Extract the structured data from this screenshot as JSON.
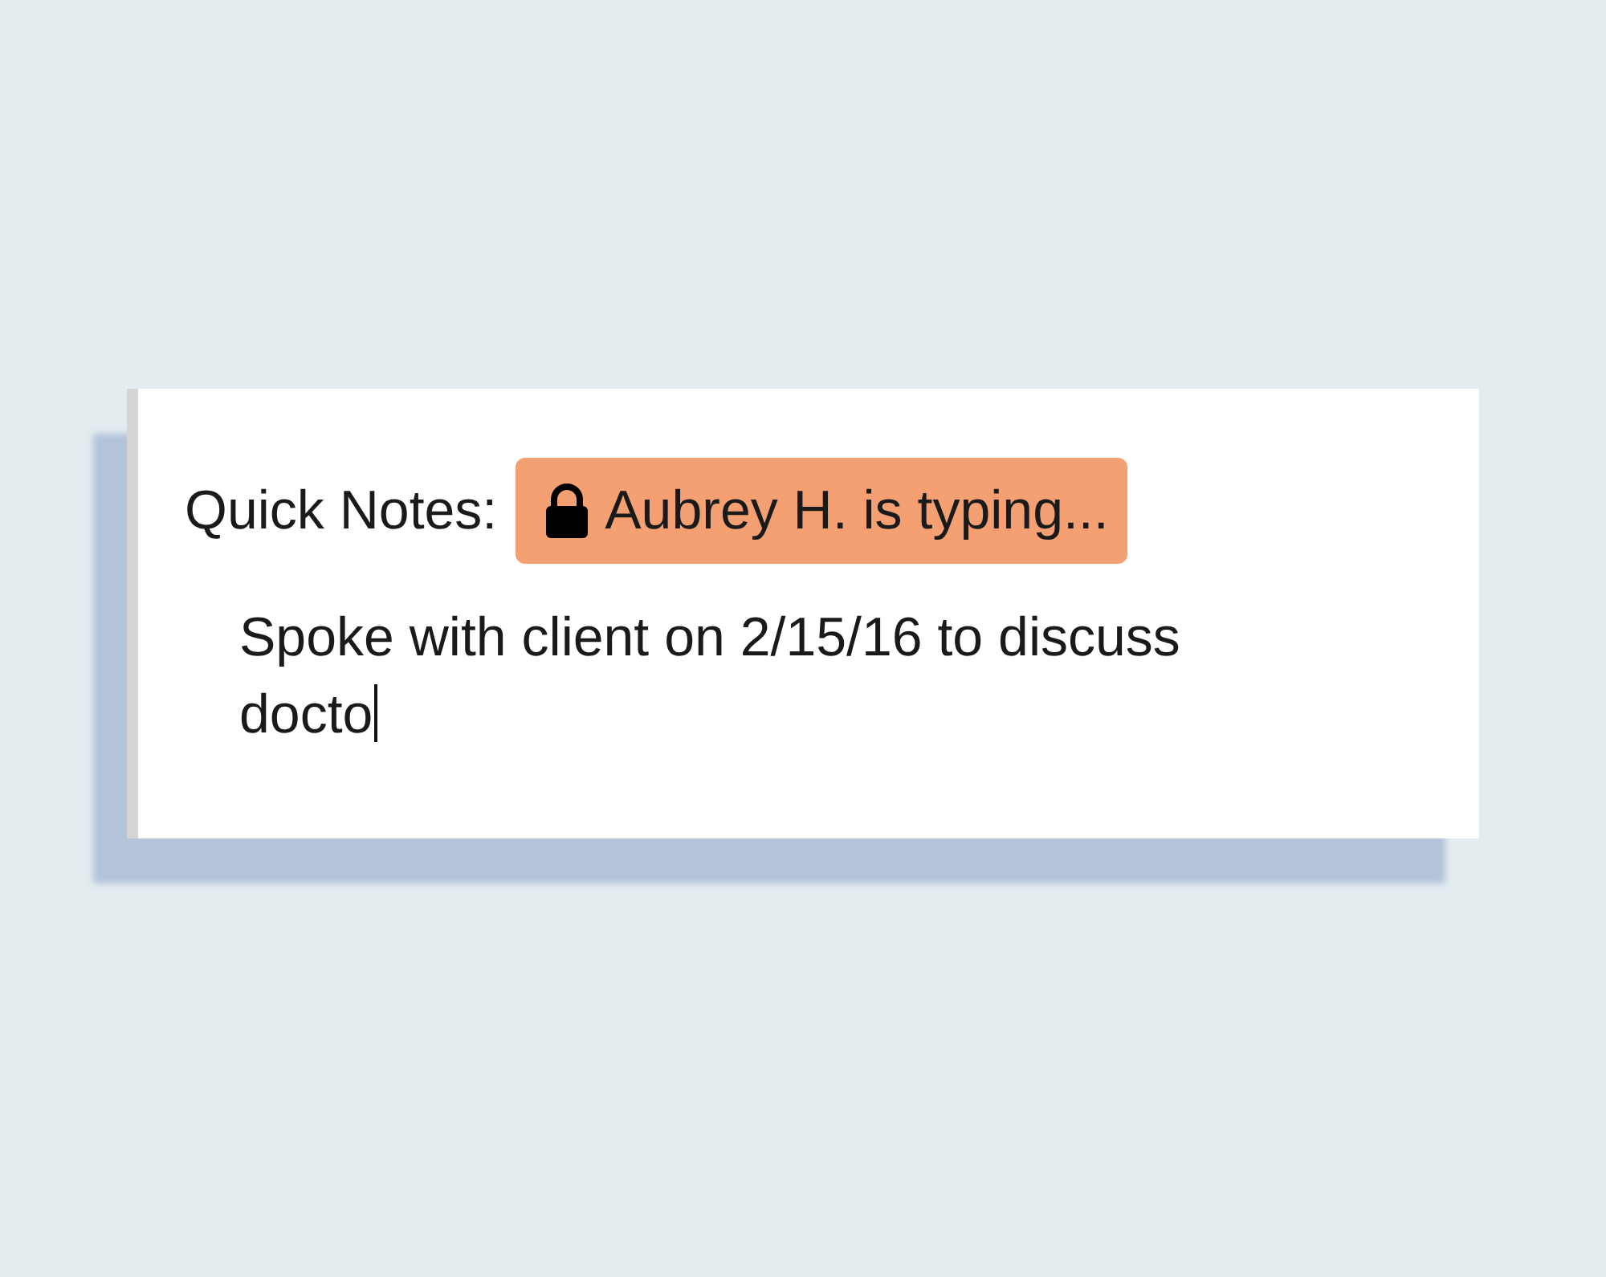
{
  "quick_notes": {
    "label": "Quick Notes:",
    "typing_badge": {
      "text": "Aubrey H. is typing...",
      "locked": true
    },
    "note": {
      "value": "Spoke with client on 2/15/16 to discuss docto",
      "focused": true
    }
  }
}
